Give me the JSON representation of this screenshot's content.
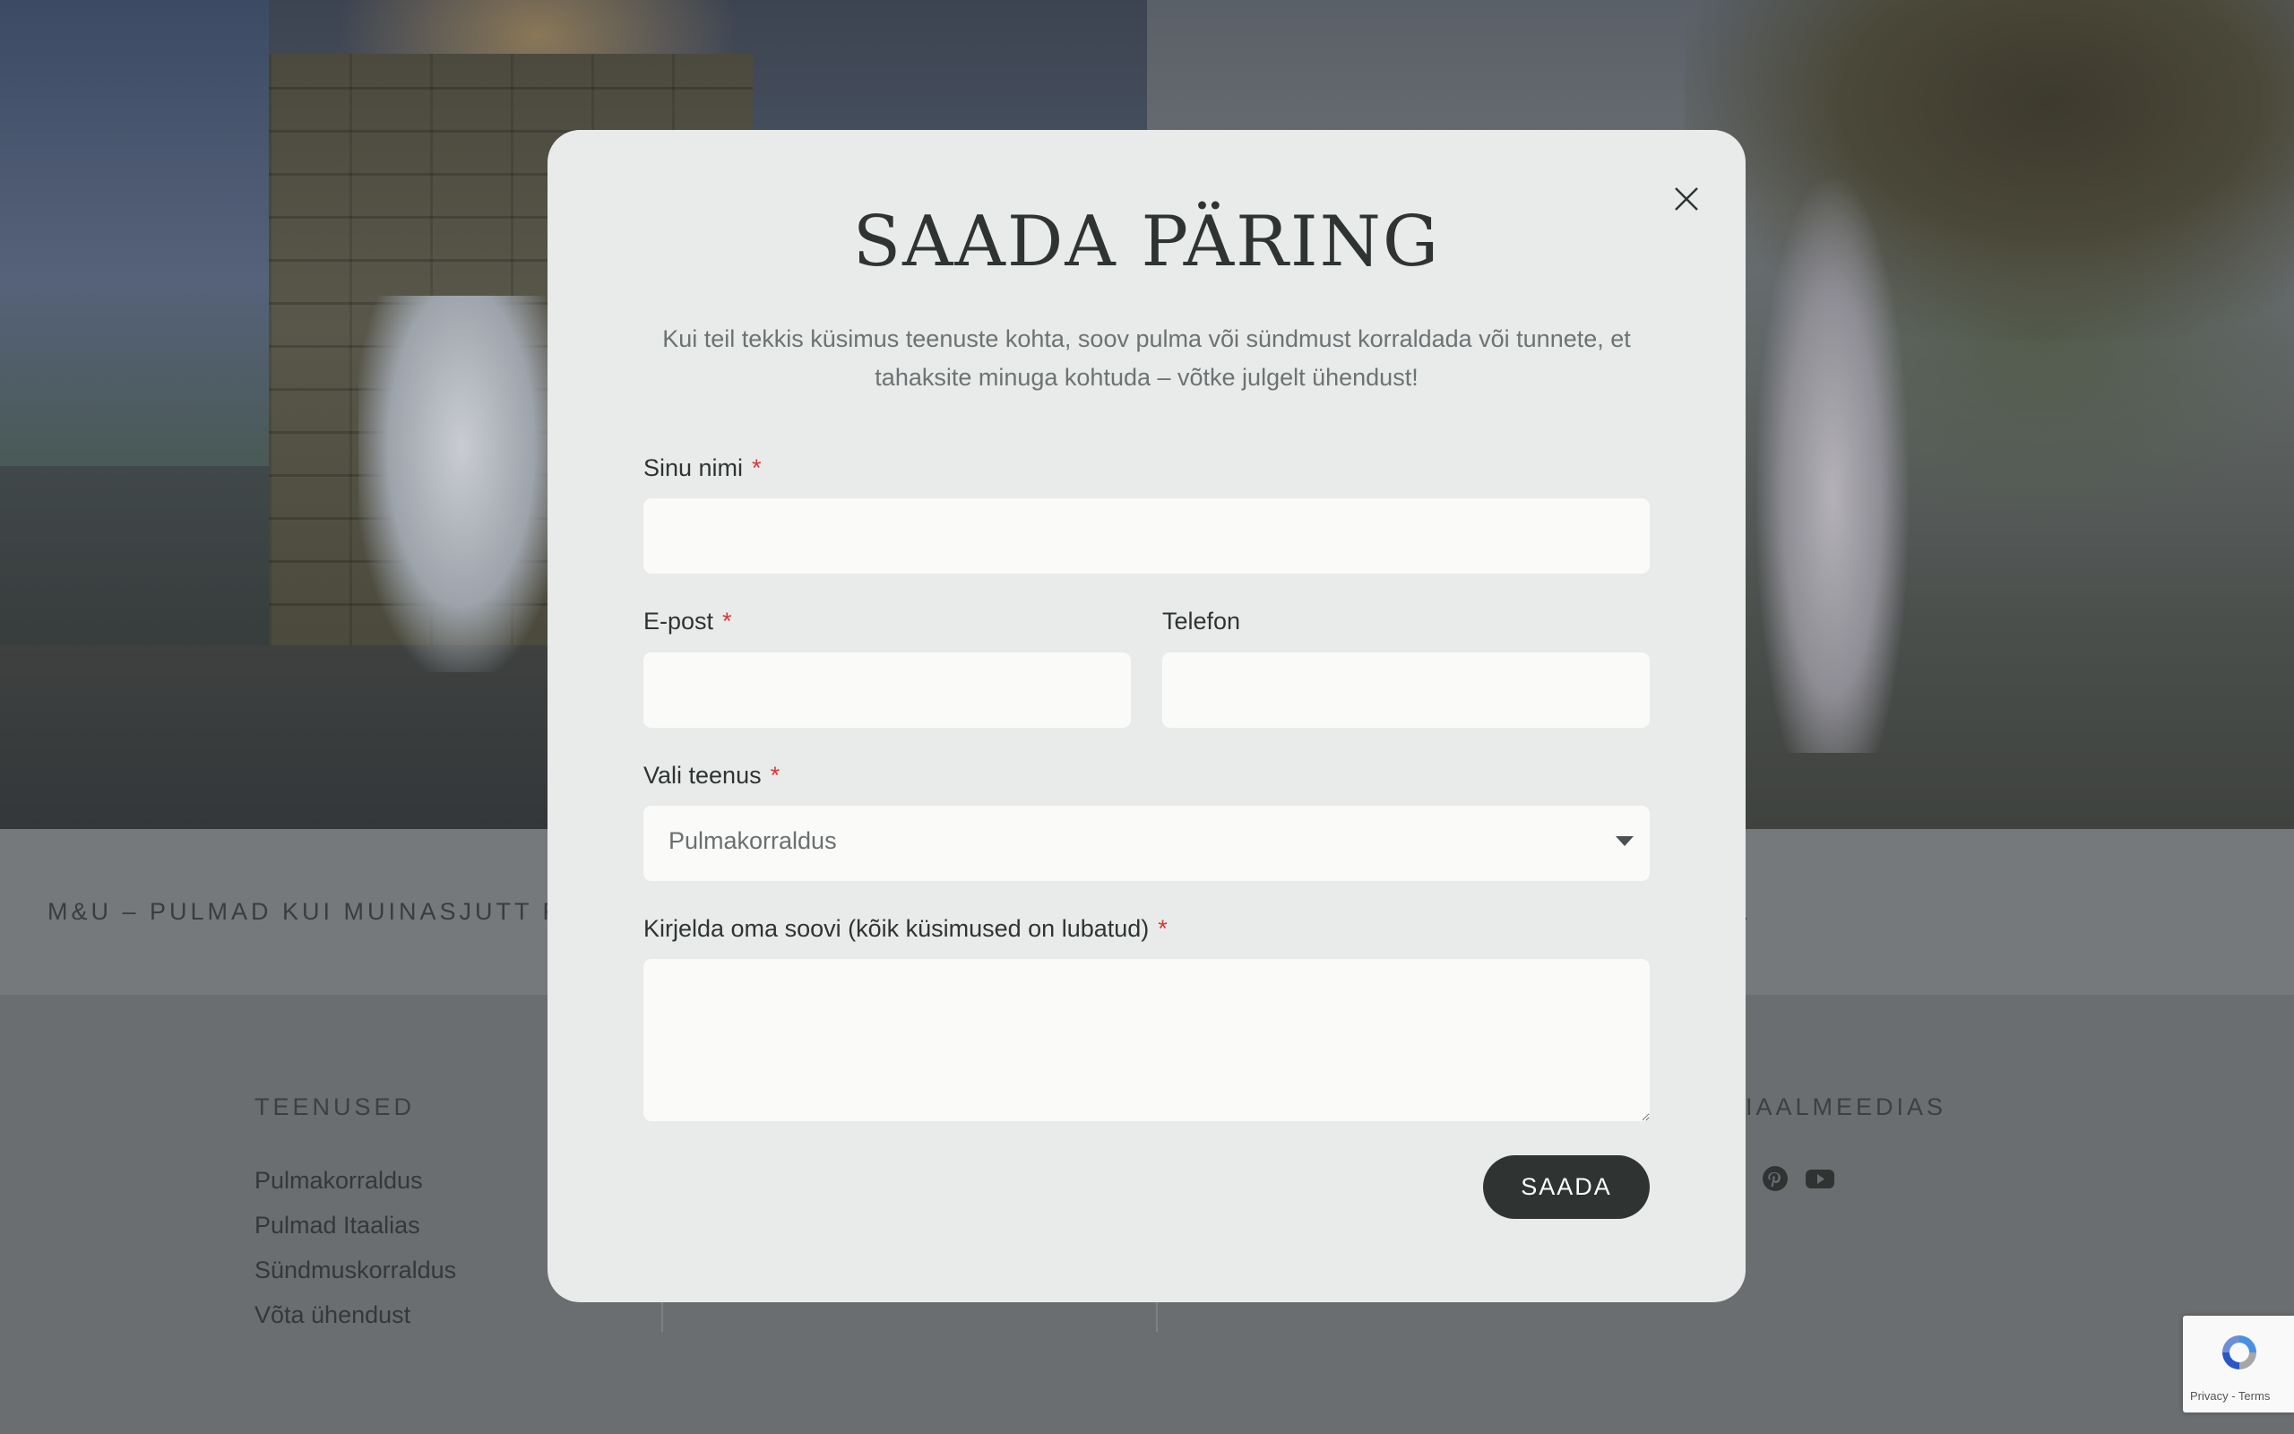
{
  "background": {
    "tagline_left": "M&U – PULMAD KUI MUINASJUTT FIR",
    "tagline_right": "L",
    "footer": {
      "services_heading": "TEENUSED",
      "services": [
        "Pulmakorraldus",
        "Pulmad Itaalias",
        "Sündmuskorraldus",
        "Võta ühendust"
      ],
      "social_heading": "IAALMEEDIAS",
      "social_icons": [
        "instagram-icon",
        "pinterest-icon",
        "youtube-icon"
      ]
    },
    "recaptcha_terms": "Privacy - Terms"
  },
  "modal": {
    "title": "SAADA PÄRING",
    "intro": "Kui teil tekkis küsimus teenuste kohta, soov pulma või sündmust korraldada või tunnete, et tahaksite minuga kohtuda – võtke julgelt ühendust!",
    "fields": {
      "name_label": "Sinu nimi",
      "name_value": "",
      "email_label": "E-post",
      "email_value": "",
      "phone_label": "Telefon",
      "phone_value": "",
      "service_label": "Vali teenus",
      "service_value": "Pulmakorraldus",
      "message_label": "Kirjelda oma soovi (kõik küsimused on lubatud)",
      "message_value": "",
      "required_mark": "*"
    },
    "submit_label": "SAADA"
  },
  "colors": {
    "accent_dark": "#2f3433",
    "required": "#d63638",
    "modal_bg": "#e9ebea"
  }
}
